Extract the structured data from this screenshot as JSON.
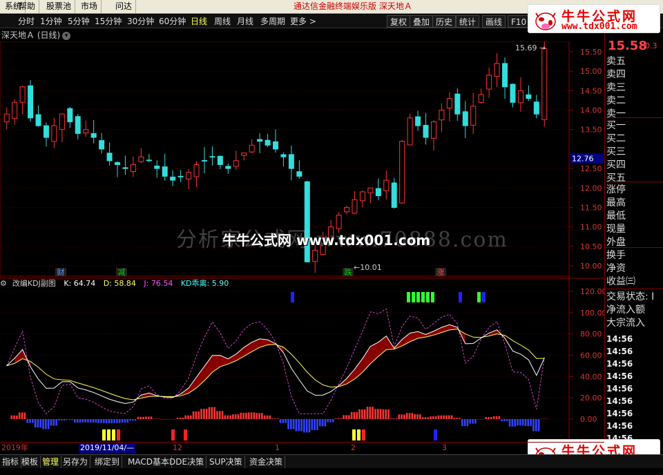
{
  "menubar": {
    "items": [
      "系统",
      "帮助",
      "股票池",
      "市场",
      "问达"
    ],
    "title": "通达信金融终端娱乐版 深天地Ａ"
  },
  "period_bar": {
    "periods": [
      "分时",
      "1分钟",
      "5分钟",
      "15分钟",
      "30分钟",
      "60分钟",
      "日线",
      "周线",
      "月线",
      "多周期",
      "更多 >"
    ],
    "active": "日线",
    "tools": [
      "复权",
      "叠加",
      "历史",
      "统计",
      "画线",
      "F10"
    ]
  },
  "stock_title": "深天地Ａ (日线)",
  "price_axis": [
    "15.50",
    "15.00",
    "14.50",
    "14.00",
    "13.50",
    "12.50",
    "12.00",
    "11.50",
    "11.00",
    "10.50",
    "10.00"
  ],
  "price_axis_highlight": "12.76",
  "price_annotations": {
    "high": "15.69",
    "low": "10.01"
  },
  "event_markers": [
    {
      "label": "财",
      "color": "#5599ff"
    },
    {
      "label": "减",
      "color": "#00cc00"
    },
    {
      "label": "跌",
      "color": "#00cc00"
    },
    {
      "label": "涨",
      "color": "#ff4444"
    }
  ],
  "kdj_header": {
    "name": "改编KDJ副图",
    "k": "K: 64.74",
    "d": "D: 58.84",
    "j": "J: 76.54",
    "kd": "KD乖离: 5.90"
  },
  "kdj_axis": [
    "120.00",
    "100.00",
    "80.00",
    "60.00",
    "40.00",
    "20.00",
    "0.00"
  ],
  "right_panel": {
    "price": "15.58",
    "change": "0.3",
    "sell_labels": [
      "卖五",
      "卖四",
      "卖三",
      "卖二",
      "卖一"
    ],
    "buy_labels": [
      "买一",
      "买二",
      "买三",
      "买四",
      "买五"
    ],
    "stats_labels": [
      "涨停",
      "最高",
      "最低",
      "现量",
      "外盘"
    ],
    "more_labels": [
      "换手",
      "净资",
      "收益㈢"
    ],
    "status_labels": [
      "交易状态: I",
      "净流入额",
      "大宗流入"
    ],
    "times": [
      "14:56",
      "14:56",
      "14:56",
      "14:56",
      "14:56",
      "14:56",
      "14:56",
      "14:56",
      "14:56"
    ]
  },
  "bottom_axis": [
    {
      "text": "2019年",
      "hl": false
    },
    {
      "text": "2019/11/04/—",
      "hl": true
    },
    {
      "text": "12",
      "hl": false
    },
    {
      "text": "1",
      "hl": false
    },
    {
      "text": "2",
      "hl": false
    },
    {
      "text": "3",
      "hl": false
    }
  ],
  "tabbar": [
    "指标",
    "模板",
    "管理",
    "另存为",
    "绑定到",
    "MACD基本",
    "DDE决策",
    "SUP决策",
    "资金决策"
  ],
  "tabbar_active": "管理",
  "watermark": {
    "faint": "分析家公式网 www.70888.com",
    "main": "牛牛公式网 www.tdx001.com"
  },
  "logo": {
    "title": "牛牛公式网",
    "url": "www.tdx001.com"
  },
  "chart_data": {
    "type": "candlestick",
    "approx_closes": [
      13.9,
      14.2,
      14.6,
      13.8,
      13.6,
      13.3,
      13.6,
      13.9,
      13.7,
      13.4,
      13.5,
      13.3,
      13.0,
      12.7,
      12.6,
      12.5,
      12.6,
      12.8,
      12.7,
      12.5,
      12.3,
      12.2,
      12.3,
      12.4,
      12.6,
      12.7,
      12.8,
      12.6,
      12.5,
      12.7,
      12.9,
      13.1,
      13.2,
      13.1,
      13.0,
      12.8,
      12.5,
      12.3,
      10.1,
      10.4,
      10.7,
      11.0,
      11.3,
      11.5,
      11.7,
      11.9,
      12.0,
      11.8,
      12.2,
      11.5,
      13.2,
      13.8,
      13.6,
      13.3,
      13.7,
      14.0,
      14.3,
      13.9,
      13.6,
      14.1,
      14.4,
      14.9,
      15.2,
      14.6,
      14.2,
      14.5,
      14.3,
      13.9,
      15.58
    ],
    "kdj": {
      "k": 64.74,
      "d": 58.84,
      "j": 76.54,
      "kd_deviation": 5.9
    }
  }
}
